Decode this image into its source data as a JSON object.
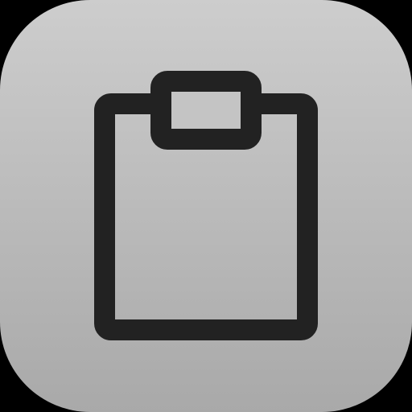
{
  "app_icon": {
    "icon_name": "clipboard-icon",
    "background_color_top": "#cdcdcd",
    "background_color_bottom": "#a9a9a9",
    "glyph_color": "#222222"
  }
}
